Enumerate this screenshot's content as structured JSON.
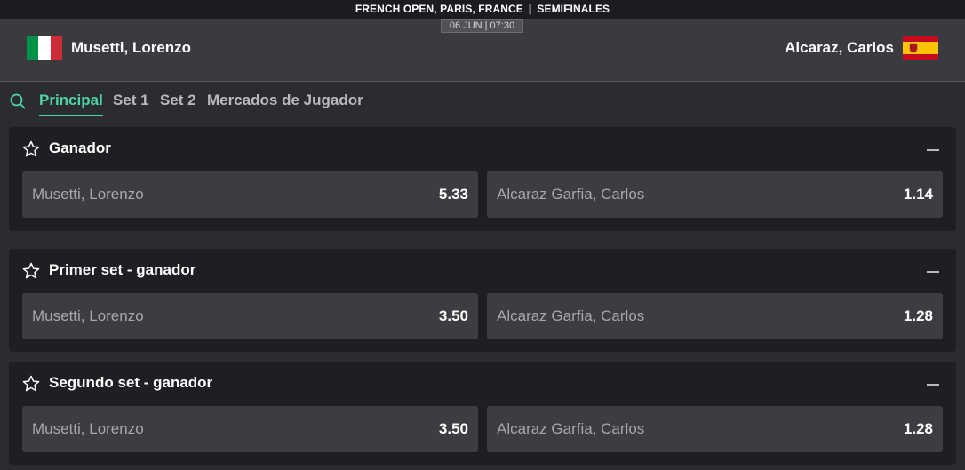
{
  "header": {
    "tournament": "FRENCH OPEN, PARIS, FRANCE",
    "separator": "|",
    "round": "SEMIFINALES",
    "datetime": "06 JUN | 07:30",
    "home_team": "Musetti, Lorenzo",
    "away_team": "Alcaraz, Carlos",
    "home_flag_icon": "italy-flag-icon",
    "away_flag_icon": "spain-flag-icon"
  },
  "colors": {
    "accent": "#4fd1a5",
    "background": "#2b2c2f",
    "card": "#1e1f22",
    "odd_button": "#3c3d41"
  },
  "tabs": [
    {
      "label": "Principal",
      "active": true
    },
    {
      "label": "Set 1",
      "active": false
    },
    {
      "label": "Set 2",
      "active": false
    },
    {
      "label": "Mercados de Jugador",
      "active": false
    }
  ],
  "markets": [
    {
      "title": "Ganador",
      "outcomes": [
        {
          "name": "Musetti, Lorenzo",
          "price": "5.33"
        },
        {
          "name": "Alcaraz Garfia, Carlos",
          "price": "1.14"
        }
      ]
    },
    {
      "title": "Primer set - ganador",
      "outcomes": [
        {
          "name": "Musetti, Lorenzo",
          "price": "3.50"
        },
        {
          "name": "Alcaraz Garfia, Carlos",
          "price": "1.28"
        }
      ]
    },
    {
      "title": "Segundo set - ganador",
      "outcomes": [
        {
          "name": "Musetti, Lorenzo",
          "price": "3.50"
        },
        {
          "name": "Alcaraz Garfia, Carlos",
          "price": "1.28"
        }
      ]
    }
  ]
}
